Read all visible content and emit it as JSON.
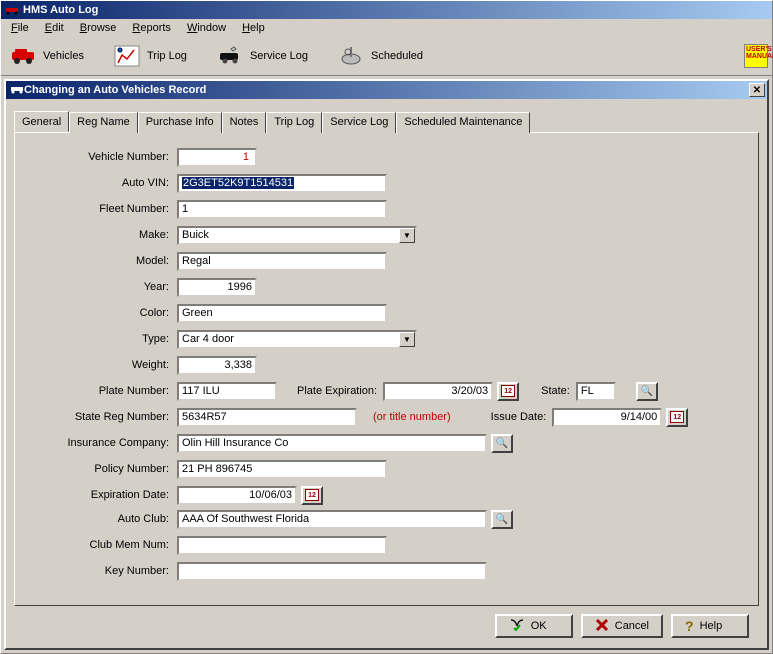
{
  "app_title": "HMS Auto Log",
  "menus": [
    "File",
    "Edit",
    "Browse",
    "Reports",
    "Window",
    "Help"
  ],
  "menu_underscores": [
    "F",
    "E",
    "B",
    "R",
    "W",
    "H"
  ],
  "toolbar": {
    "vehicles": "Vehicles",
    "trip_log": "Trip Log",
    "service_log": "Service Log",
    "scheduled": "Scheduled",
    "users_manual": "USER'S MANUAL"
  },
  "child_title": "Changing an Auto Vehicles Record",
  "tabs": [
    "General",
    "Reg Name",
    "Purchase Info",
    "Notes",
    "Trip Log",
    "Service Log",
    "Scheduled Maintenance"
  ],
  "active_tab_index": 0,
  "labels": {
    "vehicle_number": "Vehicle Number:",
    "auto_vin": "Auto VIN:",
    "fleet_number": "Fleet Number:",
    "make": "Make:",
    "model": "Model:",
    "year": "Year:",
    "color": "Color:",
    "type": "Type:",
    "weight": "Weight:",
    "plate_number": "Plate Number:",
    "plate_expiration": "Plate Expiration:",
    "state": "State:",
    "state_reg_number": "State Reg Number:",
    "or_title_number": "(or title number)",
    "issue_date": "Issue Date:",
    "insurance_company": "Insurance Company:",
    "policy_number": "Policy Number:",
    "expiration_date": "Expiration Date:",
    "auto_club": "Auto Club:",
    "club_mem_num": "Club Mem Num:",
    "key_number": "Key Number:"
  },
  "values": {
    "vehicle_number": "1",
    "auto_vin": "2G3ET52K9T1514531",
    "fleet_number": "1",
    "make": "Buick",
    "model": "Regal",
    "year": "1996",
    "color": "Green",
    "type": "Car 4 door",
    "weight": "3,338",
    "plate_number": "117 ILU",
    "plate_expiration": "3/20/03",
    "state": "FL",
    "state_reg_number": "5634R57",
    "issue_date": "9/14/00",
    "insurance_company": "Olin Hill Insurance Co",
    "policy_number": "21 PH 896745",
    "expiration_date": "10/06/03",
    "auto_club": "AAA Of Southwest Florida",
    "club_mem_num": "",
    "key_number": ""
  },
  "buttons": {
    "ok": "OK",
    "cancel": "Cancel",
    "help": "Help"
  }
}
